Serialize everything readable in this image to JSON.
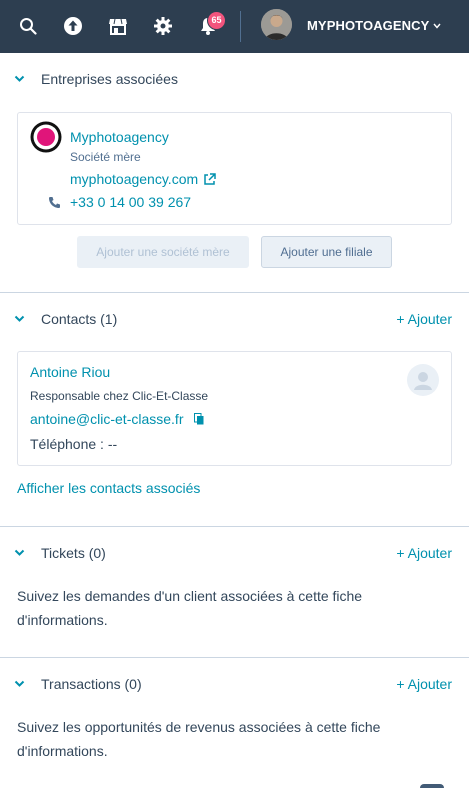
{
  "topbar": {
    "notifications_count": "65",
    "account_name": "MYPHOTOAGENCY",
    "icons": [
      "search-icon",
      "upload-icon",
      "marketplace-icon",
      "settings-icon",
      "bell-icon"
    ]
  },
  "companies": {
    "title": "Entreprises associées",
    "company": {
      "name": "Myphotoagency",
      "role": "Société mère",
      "domain": "myphotoagency.com",
      "phone": "+33 0 14 00 39 267"
    },
    "add_parent_label": "Ajouter une société mère",
    "add_child_label": "Ajouter une filiale"
  },
  "contacts": {
    "title": "Contacts (1)",
    "add_label": "+ Ajouter",
    "contact": {
      "name": "Antoine Riou",
      "job": "Responsable chez Clic-Et-Classe",
      "email": "antoine@clic-et-classe.fr",
      "phone": "Téléphone : --"
    },
    "view_all_label": "Afficher les contacts associés"
  },
  "tickets": {
    "title": "Tickets (0)",
    "add_label": "+ Ajouter",
    "description": "Suivez les demandes d'un client associées à cette fiche d'informations."
  },
  "transactions": {
    "title": "Transactions (0)",
    "add_label": "+ Ajouter",
    "description": "Suivez les opportunités de revenus associées à cette fiche d'informations."
  },
  "colors": {
    "topbar": "#2d3e50",
    "link": "#0091ae",
    "text": "#33475b",
    "badge": "#f2547d"
  }
}
